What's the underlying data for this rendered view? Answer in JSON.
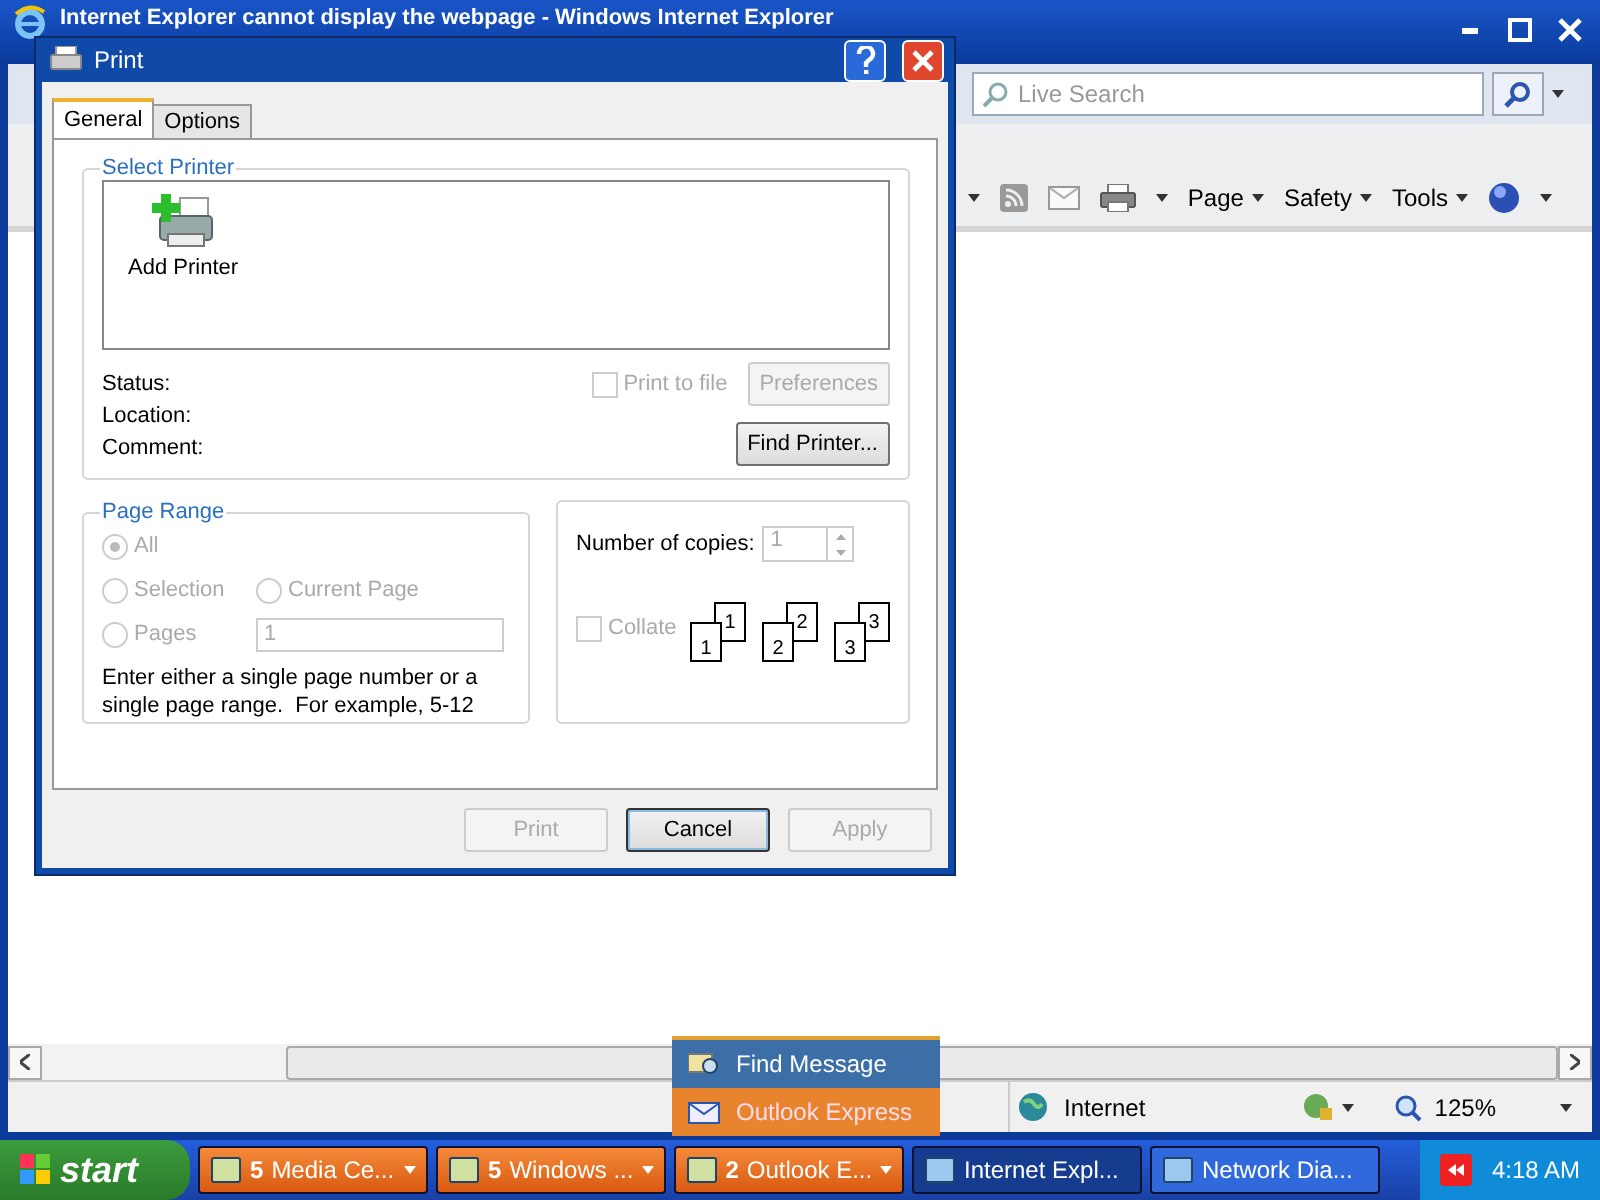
{
  "browser": {
    "title": "Internet Explorer cannot display the webpage - Windows Internet Explorer",
    "search_placeholder": "Live Search",
    "commands": [
      {
        "label": "Page"
      },
      {
        "label": "Safety"
      },
      {
        "label": "Tools"
      }
    ],
    "zone": "Internet",
    "zoom": "125%"
  },
  "dialog": {
    "title": "Print",
    "tabs": [
      {
        "label": "General",
        "selected": true
      },
      {
        "label": "Options",
        "selected": false
      }
    ],
    "printer_group": {
      "title": "Select Printer",
      "printers": [
        {
          "label": "Add Printer"
        }
      ]
    },
    "info_labels": [
      "Status:",
      "Location:",
      "Comment:"
    ],
    "print_to_file": {
      "label": "Print to file",
      "checked": false,
      "disabled": true
    },
    "preferences": {
      "label": "Preferences",
      "disabled": true
    },
    "find_printer": {
      "label": "Find Printer...",
      "disabled": false
    },
    "page_range": {
      "title": "Page Range",
      "options": [
        {
          "label": "All",
          "selected": true,
          "disabled": true
        },
        {
          "label": "Selection",
          "selected": false,
          "disabled": true
        },
        {
          "label": "Current Page",
          "selected": false,
          "disabled": true
        },
        {
          "label": "Pages",
          "selected": false,
          "disabled": true
        }
      ],
      "pages_value": "1",
      "hint": "Enter either a single page number or a single page range.  For example, 5-12"
    },
    "copies": {
      "label": "Number of copies:",
      "value": "1",
      "disabled": true,
      "collate": {
        "label": "Collate",
        "checked": false,
        "disabled": true
      },
      "stacks": [
        [
          "1",
          "1"
        ],
        [
          "2",
          "2"
        ],
        [
          "3",
          "3"
        ]
      ]
    },
    "buttons": [
      {
        "label": "Print",
        "disabled": true
      },
      {
        "label": "Cancel",
        "disabled": false
      },
      {
        "label": "Apply",
        "disabled": true
      }
    ]
  },
  "jump_menu": {
    "items": [
      {
        "label": "Find Message",
        "selected": false
      },
      {
        "label": "Outlook Express",
        "selected": true
      }
    ]
  },
  "taskbar": {
    "start": "start",
    "buttons": [
      {
        "kind": "group",
        "count": "5",
        "label": "Media Ce...",
        "selected": false
      },
      {
        "kind": "group",
        "count": "5",
        "label": "Windows ...",
        "selected": false
      },
      {
        "kind": "group",
        "count": "2",
        "label": "Outlook E...",
        "selected": false
      },
      {
        "kind": "window",
        "label": "Internet Expl...",
        "selected": true
      },
      {
        "kind": "window",
        "label": "Network Dia...",
        "selected": false
      }
    ],
    "clock": "4:18 AM"
  }
}
